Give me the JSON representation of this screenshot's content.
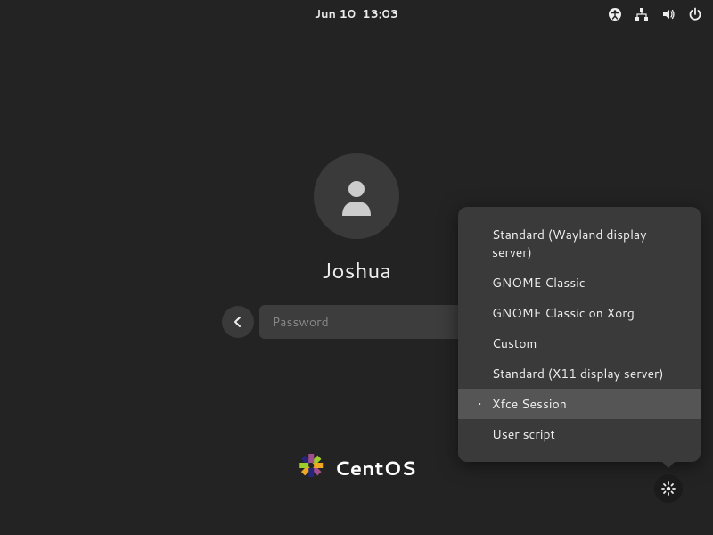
{
  "topbar": {
    "date": "Jun 10",
    "time": "13:03"
  },
  "login": {
    "username": "Joshua",
    "password_placeholder": "Password"
  },
  "distro": {
    "name": "CentOS"
  },
  "sessions": {
    "items": [
      {
        "label": "Standard (Wayland display server)",
        "selected": false
      },
      {
        "label": "GNOME Classic",
        "selected": false
      },
      {
        "label": "GNOME Classic on Xorg",
        "selected": false
      },
      {
        "label": "Custom",
        "selected": false
      },
      {
        "label": "Standard (X11 display server)",
        "selected": false
      },
      {
        "label": "Xfce Session",
        "selected": true
      },
      {
        "label": "User script",
        "selected": false
      }
    ]
  }
}
